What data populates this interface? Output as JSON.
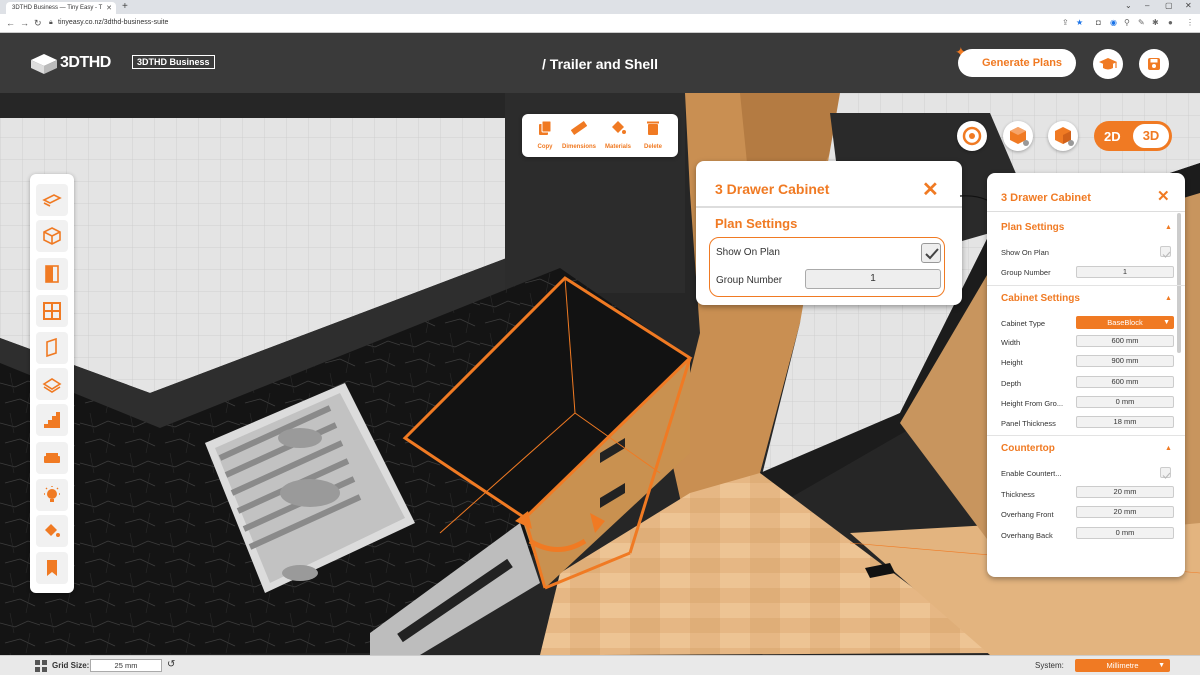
{
  "browser": {
    "tab_title": "3DTHD Business — Tiny Easy - T",
    "url": "tinyeasy.co.nz/3dthd-business-suite"
  },
  "header": {
    "brand": "3DTHD",
    "badge": "3DTHD Business",
    "title": "/ Trailer and Shell",
    "generate_label": "Generate Plans"
  },
  "toolbar": {
    "items": [
      {
        "label": "Copy",
        "icon": "copy-icon"
      },
      {
        "label": "Dimensions",
        "icon": "ruler-icon"
      },
      {
        "label": "Materials",
        "icon": "paint-bucket-icon"
      },
      {
        "label": "Delete",
        "icon": "trash-icon"
      }
    ]
  },
  "view": {
    "mode_2d": "2D",
    "mode_3d": "3D",
    "active": "3D"
  },
  "zoom_panel": {
    "title": "3 Drawer Cabinet",
    "section": "Plan Settings",
    "show_on_plan_label": "Show On Plan",
    "show_on_plan": true,
    "group_number_label": "Group Number",
    "group_number": "1"
  },
  "panel": {
    "title": "3 Drawer Cabinet",
    "plan_settings": {
      "title": "Plan Settings",
      "show_on_plan_label": "Show On Plan",
      "group_number_label": "Group Number",
      "group_number": "1"
    },
    "cabinet_settings": {
      "title": "Cabinet Settings",
      "type_label": "Cabinet Type",
      "type_value": "BaseBlock",
      "width_label": "Width",
      "width_value": "600 mm",
      "height_label": "Height",
      "height_value": "900 mm",
      "depth_label": "Depth",
      "depth_value": "600 mm",
      "hfg_label": "Height From Gro...",
      "hfg_value": "0 mm",
      "panel_label": "Panel Thickness",
      "panel_value": "18 mm"
    },
    "countertop": {
      "title": "Countertop",
      "enable_label": "Enable Countert...",
      "thickness_label": "Thickness",
      "thickness_value": "20 mm",
      "front_label": "Overhang Front",
      "front_value": "20 mm",
      "back_label": "Overhang Back",
      "back_value": "0 mm"
    }
  },
  "status": {
    "grid_label": "Grid Size:",
    "grid_value": "25 mm",
    "system_label": "System:",
    "system_value": "Millimetre"
  },
  "colors": {
    "accent": "#f07a23",
    "header": "#3a3a3a"
  }
}
